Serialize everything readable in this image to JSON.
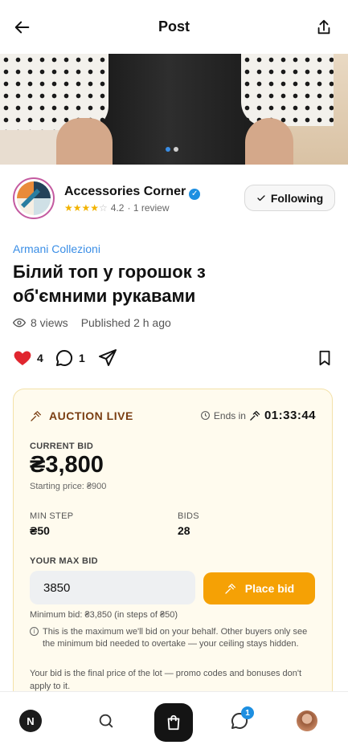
{
  "header": {
    "title": "Post"
  },
  "seller": {
    "name": "Accessories Corner",
    "rating": "4.2",
    "reviews": "· 1 review",
    "follow_label": "Following"
  },
  "post": {
    "brand": "Armani Collezioni",
    "title": "Білий топ у горошок з об'ємними рукавами",
    "views": "8 views",
    "published": "Published 2 h ago"
  },
  "reactions": {
    "likes": "4",
    "comments": "1"
  },
  "auction": {
    "status": "AUCTION LIVE",
    "ends_label": "Ends in",
    "time_left": "01:33:44",
    "current_bid_label": "CURRENT BID",
    "current_bid": "₴3,800",
    "starting_price": "Starting price: ₴900",
    "min_step_label": "MIN STEP",
    "min_step": "₴50",
    "bids_label": "BIDS",
    "bids": "28",
    "max_bid_label": "YOUR MAX BID",
    "max_bid_value": "3850",
    "place_bid_label": "Place bid",
    "min_bid_note": "Minimum bid: ₴3,850 (in steps of ₴50)",
    "info_note": "This is the maximum we'll bid on your behalf. Other buyers only see the minimum bid needed to overtake — your ceiling stays hidden.",
    "final_note": "Your bid is the final price of the lot — promo codes and bonuses don't apply to it."
  },
  "tabbar": {
    "profile_initial": "N",
    "messages_badge": "1"
  },
  "colors": {
    "accent": "#f5a105",
    "link": "#3a8ee6",
    "verified": "#1d8fe1",
    "like": "#e0262f"
  }
}
